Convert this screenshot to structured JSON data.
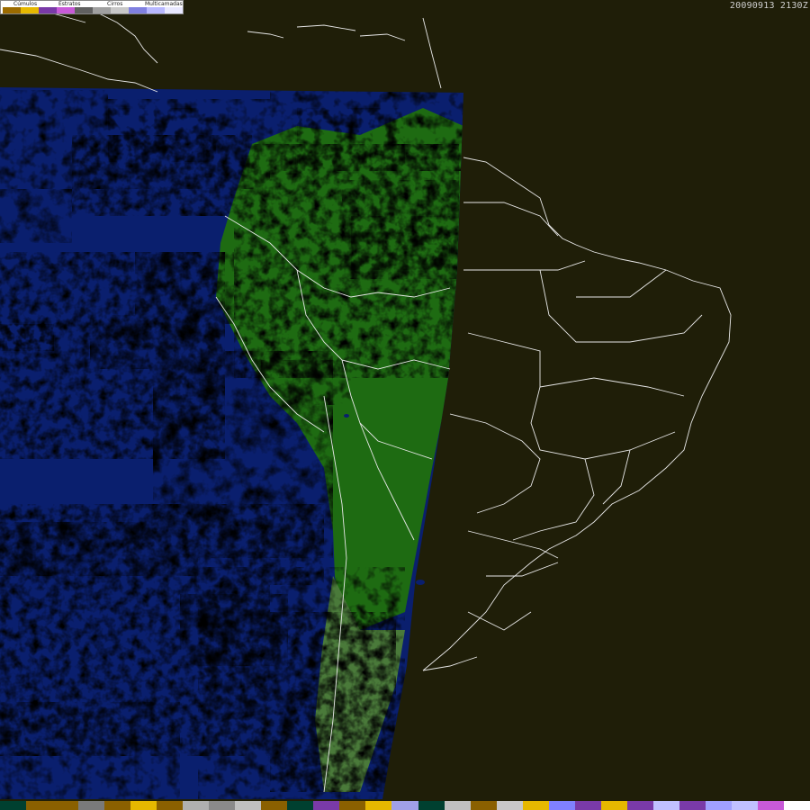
{
  "timestamp": "20090913 2130Z",
  "legend": {
    "labels": [
      "Cúmulos",
      "Estratos",
      "Cirros",
      "Multicamadas"
    ],
    "colors": [
      "#9b6b00",
      "#e6b800",
      "#7a3aa8",
      "#c85ad8",
      "#606060",
      "#a0a0a0",
      "#c8c8c8",
      "#8080e0",
      "#b8b8ff",
      "#e8e8ff"
    ]
  },
  "map": {
    "background": "#1f1e08",
    "ocean_color": "#0a1f6e",
    "land_color": "#1e6b12",
    "border_color": "#e8e8e8",
    "cloud_colors": {
      "cumulus_low": "#c9a000",
      "stratus": "#8a3cc4",
      "cirrus": "#c8c8ff",
      "multilayer": "#a8a8e8"
    }
  },
  "bottom_bar_colors": [
    "#004030",
    "#8a6000",
    "#8a6000",
    "#7a7a7a",
    "#8a6000",
    "#e6b800",
    "#8a6000",
    "#b0b0b0",
    "#8a8a8a",
    "#c0c0c0",
    "#8a6000",
    "#004030",
    "#7a3aa8",
    "#8a6000",
    "#e6b800",
    "#a0a0e8",
    "#004030",
    "#c0c0c0",
    "#8a6000",
    "#c8c8c8",
    "#e6b800",
    "#8080ff",
    "#7a3aa8",
    "#e6b800",
    "#7a3aa8",
    "#c0c0ff",
    "#7a3aa8",
    "#a0a0ff",
    "#c0c0ff",
    "#c85ad8",
    "#ffffff"
  ]
}
